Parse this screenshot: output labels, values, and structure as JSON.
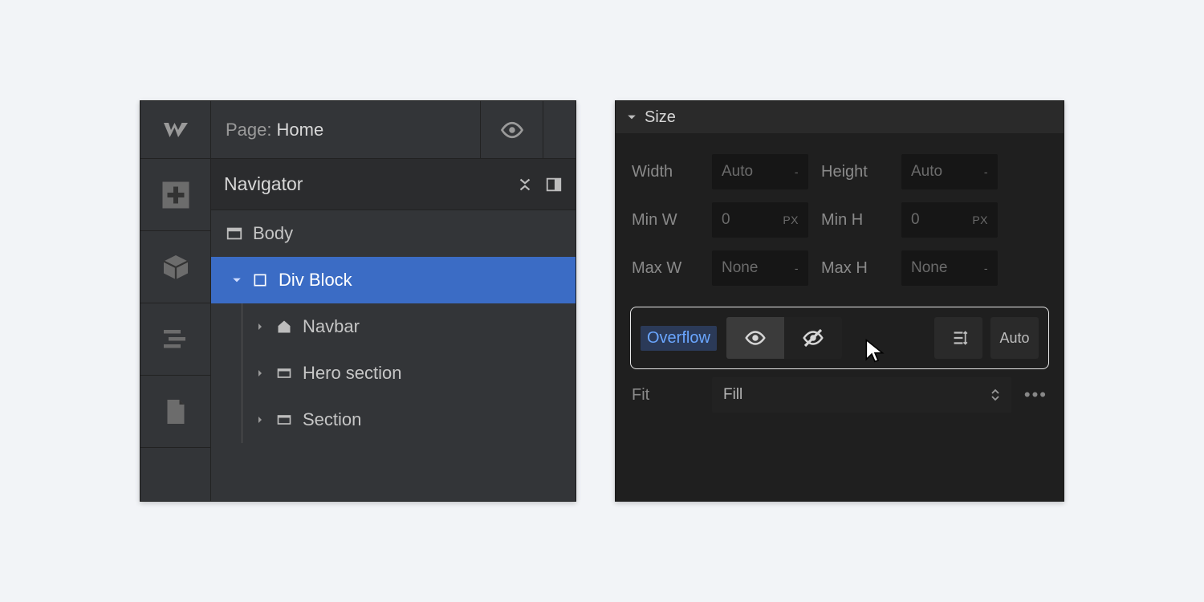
{
  "topbar": {
    "page_prefix": "Page:",
    "page_name": "Home"
  },
  "navigator": {
    "title": "Navigator",
    "tree": {
      "body": "Body",
      "divblock": "Div Block",
      "navbar": "Navbar",
      "hero": "Hero section",
      "section": "Section"
    }
  },
  "size_panel": {
    "title": "Size",
    "labels": {
      "width": "Width",
      "height": "Height",
      "minw": "Min W",
      "minh": "Min H",
      "maxw": "Max W",
      "maxh": "Max H",
      "overflow": "Overflow",
      "fit": "Fit",
      "auto_btn": "Auto"
    },
    "values": {
      "width": "Auto",
      "width_unit": "-",
      "height": "Auto",
      "height_unit": "-",
      "minw": "0",
      "minw_unit": "PX",
      "minh": "0",
      "minh_unit": "PX",
      "maxw": "None",
      "maxw_unit": "-",
      "maxh": "None",
      "maxh_unit": "-",
      "fit": "Fill"
    }
  }
}
